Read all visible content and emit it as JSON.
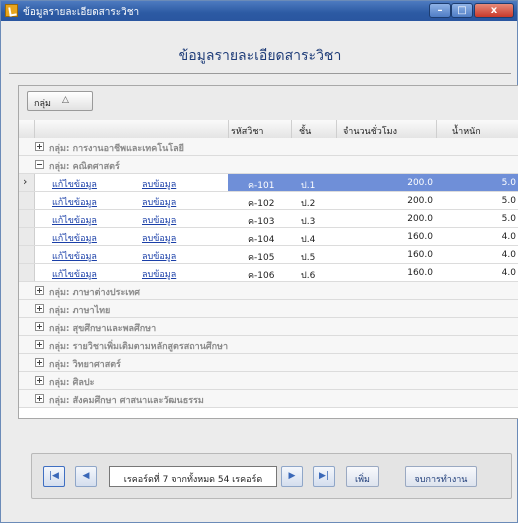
{
  "window": {
    "title": "ข้อมูลรายละเอียดสาระวิชา",
    "close_glyph": "x"
  },
  "page": {
    "title": "ข้อมูลรายละเอียดสาระวิชา"
  },
  "grouping": {
    "label": "กลุ่ม",
    "sort_glyph": "△"
  },
  "columns": {
    "code": "รหัสวิชา",
    "level": "ชั้น",
    "hours": "จำนวนชั่วโมง",
    "weight": "น้ำหนัก"
  },
  "groups": [
    "กลุ่ม: การงานอาชีพและเทคโนโลยี",
    "กลุ่ม: คณิตศาสตร์",
    "กลุ่ม: ภาษาต่างประเทศ",
    "กลุ่ม: ภาษาไทย",
    "กลุ่ม: สุขศึกษาและพลศึกษา",
    "กลุ่ม: รายวิชาเพิ่มเติมตามหลักสูตรสถานศึกษา",
    "กลุ่ม: วิทยาศาสตร์",
    "กลุ่ม: ศิลปะ",
    "กลุ่ม: สังคมศึกษา ศาสนาและวัฒนธรรม"
  ],
  "link_labels": {
    "edit": "แก้ไขข้อมูล",
    "delete": "ลบข้อมูล"
  },
  "rows": [
    {
      "code": "ค-101",
      "level": "ป.1",
      "hours": "200.0",
      "weight": "5.0"
    },
    {
      "code": "ค-102",
      "level": "ป.2",
      "hours": "200.0",
      "weight": "5.0"
    },
    {
      "code": "ค-103",
      "level": "ป.3",
      "hours": "200.0",
      "weight": "5.0"
    },
    {
      "code": "ค-104",
      "level": "ป.4",
      "hours": "160.0",
      "weight": "4.0"
    },
    {
      "code": "ค-105",
      "level": "ป.5",
      "hours": "160.0",
      "weight": "4.0"
    },
    {
      "code": "ค-106",
      "level": "ป.6",
      "hours": "160.0",
      "weight": "4.0"
    }
  ],
  "navigator": {
    "record_text": "เรคอร์ดที่ 7 จากทั้งหมด 54 เรคอร์ด",
    "add_label": "เพิ่ม",
    "end_label": "จบการทำงาน",
    "icons": [
      "first-record-icon",
      "prev-record-icon",
      "next-record-icon",
      "last-record-icon"
    ]
  },
  "colors": {
    "title_bar": "#2c5aa3",
    "selected_row": "#6f8fd8",
    "link": "#1a3fa8",
    "heading": "#1e3c78"
  }
}
